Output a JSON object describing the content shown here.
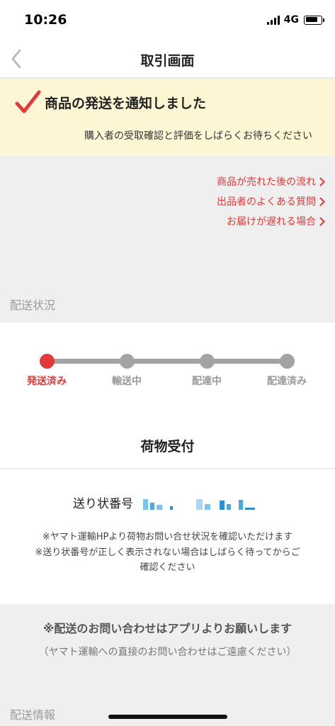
{
  "status_bar": {
    "time": "10:26",
    "network": "4G",
    "battery_level": 0.8
  },
  "nav": {
    "title": "取引画面",
    "back_icon": "chevron-left-icon"
  },
  "notice": {
    "title": "商品の発送を通知しました",
    "subtitle": "購入者の受取確認と評価をしばらくお待ちください",
    "icon": "checkmark-icon",
    "accent_color": "#e03a3a",
    "background_color": "#fdf6d5"
  },
  "help_links": [
    {
      "label": "商品が売れた後の流れ"
    },
    {
      "label": "出品者のよくある質問"
    },
    {
      "label": "お届けが遅れる場合"
    }
  ],
  "shipping_status": {
    "section_label": "配送状況",
    "steps": [
      {
        "label": "発送済み",
        "active": true
      },
      {
        "label": "輸送中",
        "active": false
      },
      {
        "label": "配達中",
        "active": false
      },
      {
        "label": "配達済み",
        "active": false
      }
    ],
    "current_step": 1,
    "package_title": "荷物受付"
  },
  "tracking": {
    "label": "送り状番号",
    "note_1": "※ヤマト運輸HPより荷物お問い合せ状況を確認いただけます",
    "note_2": "※送り状番号が正しく表示されない場合はしばらく待ってからご",
    "note_3": "確認ください"
  },
  "inquiry": {
    "title": "※配送のお問い合わせはアプリよりお願いします",
    "subtitle": "（ヤマト運輸への直接のお問い合わせはご遠慮ください）"
  },
  "shipping_info": {
    "section_label": "配送情報"
  }
}
